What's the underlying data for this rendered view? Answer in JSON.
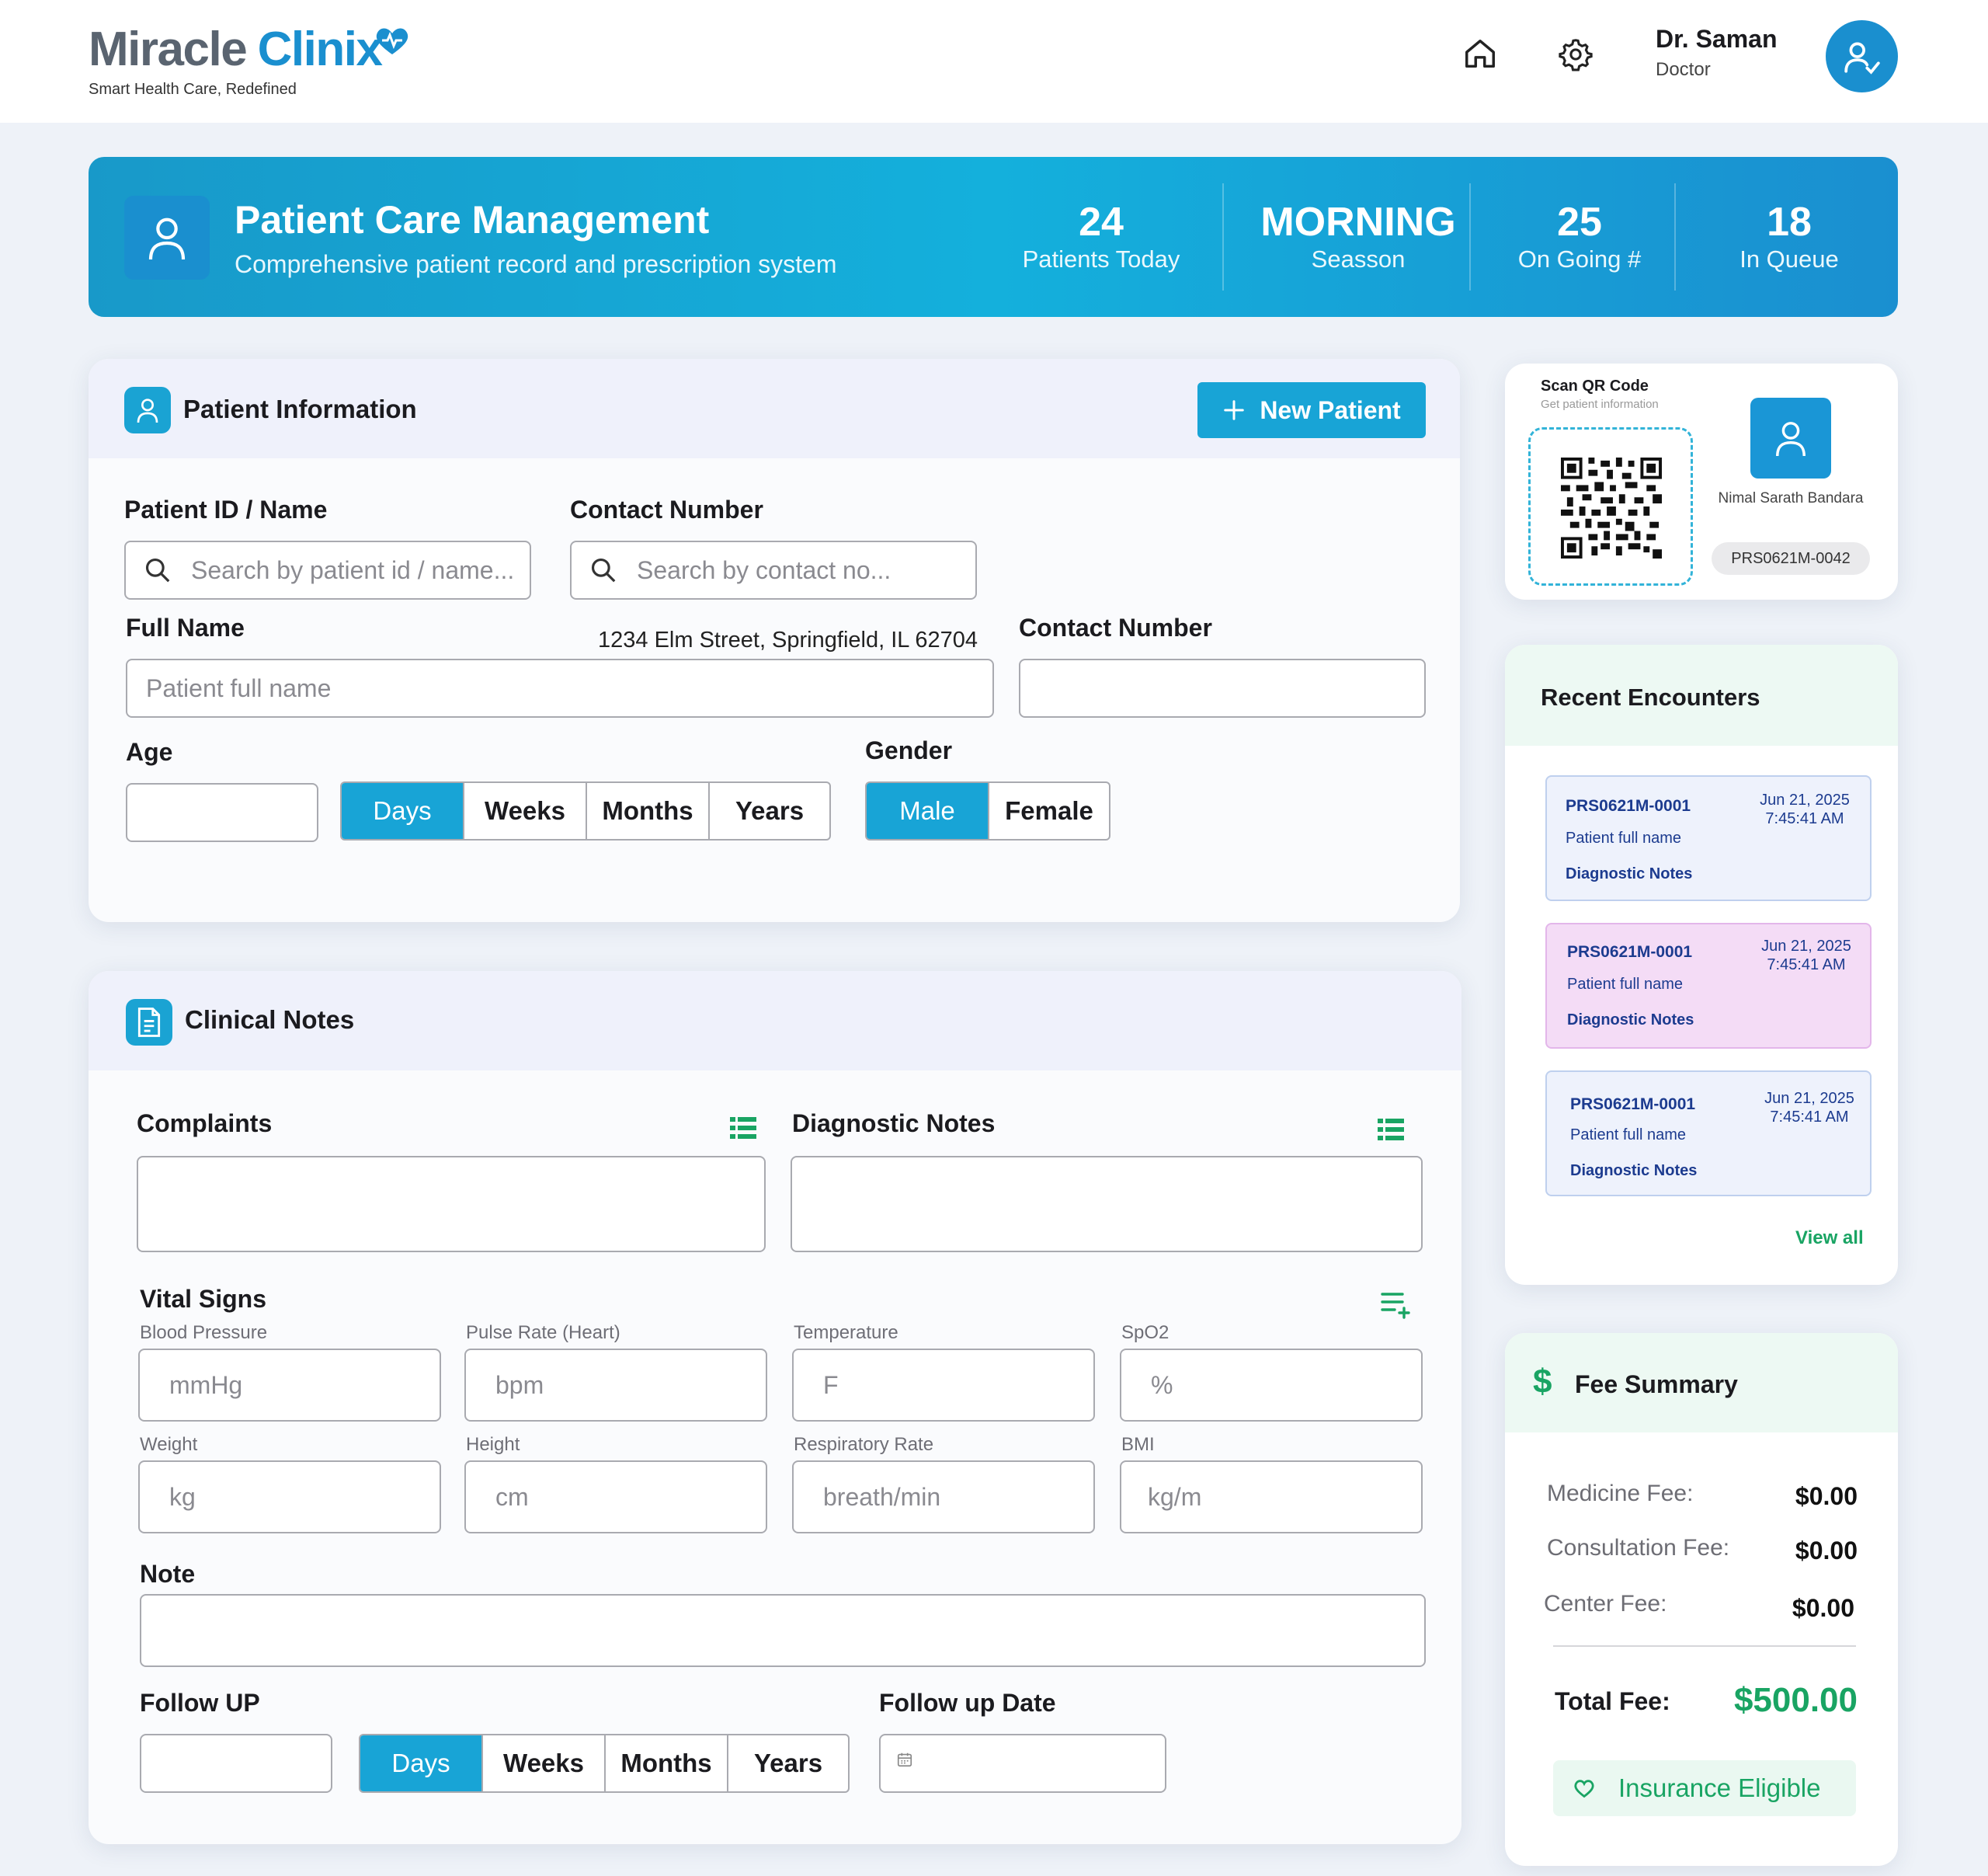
{
  "header": {
    "logo_word1": "Miracle",
    "logo_word2": "Clinix",
    "tagline": "Smart Health Care, Redefined",
    "user_name": "Dr. Saman",
    "user_role": "Doctor",
    "icons": [
      "home-icon",
      "gear-icon",
      "user-check-icon"
    ]
  },
  "banner": {
    "title": "Patient Care Management",
    "subtitle": "Comprehensive patient record and prescription system",
    "stats": [
      {
        "value": "24",
        "label": "Patients Today"
      },
      {
        "value": "MORNING",
        "label": "Seasson"
      },
      {
        "value": "25",
        "label": "On Going #"
      },
      {
        "value": "18",
        "label": "In Queue"
      }
    ]
  },
  "patient_info": {
    "title": "Patient Information",
    "new_patient_label": "New Patient",
    "id_label": "Patient ID / Name",
    "id_placeholder": "Search by patient id / name...",
    "contact_label": "Contact Number",
    "contact_placeholder": "Search by contact no...",
    "full_name_label": "Full Name",
    "address": "1234 Elm Street, Springfield, IL 62704",
    "full_name_placeholder": "Patient full name",
    "contact2_label": "Contact Number",
    "age_label": "Age",
    "age_units": [
      "Days",
      "Weeks",
      "Months",
      "Years"
    ],
    "age_unit_selected": "Days",
    "gender_label": "Gender",
    "gender_options": [
      "Male",
      "Female"
    ],
    "gender_selected": "Male"
  },
  "clinical_notes": {
    "title": "Clinical Notes",
    "complaints_label": "Complaints",
    "diagnostic_label": "Diagnostic Notes",
    "vitals_label": "Vital Signs",
    "vitals": [
      {
        "label": "Blood Pressure",
        "placeholder": "mmHg"
      },
      {
        "label": "Pulse Rate (Heart)",
        "placeholder": "bpm"
      },
      {
        "label": "Temperature",
        "placeholder": "F"
      },
      {
        "label": "SpO2",
        "placeholder": "%"
      },
      {
        "label": "Weight",
        "placeholder": "kg"
      },
      {
        "label": "Height",
        "placeholder": "cm"
      },
      {
        "label": "Respiratory Rate",
        "placeholder": "breath/min"
      },
      {
        "label": "BMI",
        "placeholder": "kg/m"
      }
    ],
    "note_label": "Note",
    "followup_label": "Follow UP",
    "followup_units": [
      "Days",
      "Weeks",
      "Months",
      "Years"
    ],
    "followup_unit_selected": "Days",
    "followup_date_label": "Follow up Date"
  },
  "qr_card": {
    "title": "Scan QR Code",
    "subtitle": "Get patient information",
    "patient_name": "Nimal Sarath Bandara",
    "patient_id": "PRS0621M-0042"
  },
  "recent_encounters": {
    "title": "Recent Encounters",
    "items": [
      {
        "id": "PRS0621M-0001",
        "date": "Jun 21, 2025",
        "time": "7:45:41 AM",
        "name": "Patient full name",
        "notes": "Diagnostic Notes",
        "bg": "#eef2fc",
        "border": "#bfd0ee"
      },
      {
        "id": "PRS0621M-0001",
        "date": "Jun 21, 2025",
        "time": "7:45:41 AM",
        "name": "Patient full name",
        "notes": "Diagnostic Notes",
        "bg": "#f4dcf6",
        "border": "#e3b6ea"
      },
      {
        "id": "PRS0621M-0001",
        "date": "Jun 21, 2025",
        "time": "7:45:41 AM",
        "name": "Patient full name",
        "notes": "Diagnostic Notes",
        "bg": "#eef2fc",
        "border": "#bfd0ee"
      }
    ],
    "view_all": "View all"
  },
  "fee_summary": {
    "title": "Fee Summary",
    "rows": [
      {
        "label": "Medicine Fee:",
        "value": "$0.00"
      },
      {
        "label": "Consultation Fee:",
        "value": "$0.00"
      },
      {
        "label": "Center Fee:",
        "value": "$0.00"
      }
    ],
    "total_label": "Total Fee:",
    "total_value": "$500.00",
    "insurance_label": "Insurance Eligible"
  },
  "colors": {
    "brand_dark": "#5a6470",
    "brand_blue": "#1a8fcf",
    "accent": "#18a4d6",
    "green": "#19a463"
  }
}
